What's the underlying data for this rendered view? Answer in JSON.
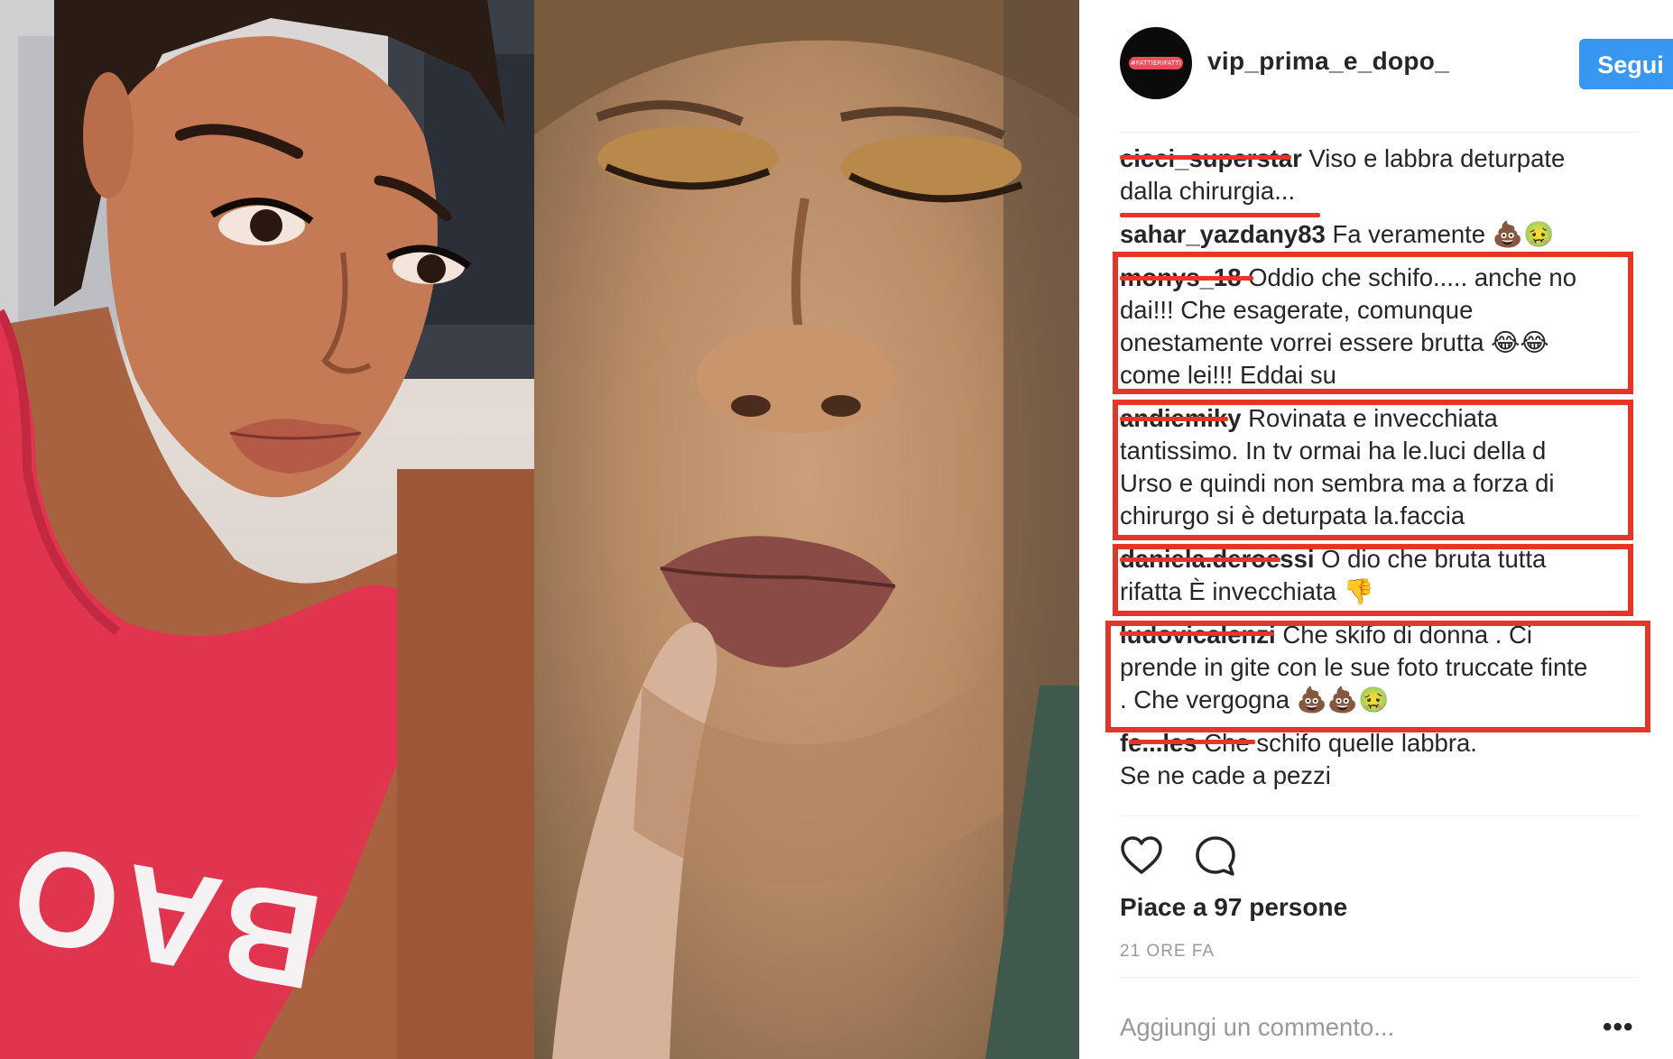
{
  "post": {
    "username": "vip_prima_e_dopo_",
    "avatar_badge": "#FATTIERIFATTI",
    "follow_label": "Segui",
    "likes_text": "Piace a 97 persone",
    "time_text": "21 ORE FA",
    "add_comment_placeholder": "Aggiungi un commento...",
    "more_label": "•••"
  },
  "photo": {
    "shirt_text": "BAO"
  },
  "comments": [
    {
      "user": "cicci_superstar",
      "lines": [
        "Viso e labbra deturpate",
        "dalla chirurgia..."
      ]
    },
    {
      "user": "sahar_yazdany83",
      "lines": [
        "Fa veramente 💩🤢"
      ]
    },
    {
      "user": "monys_18",
      "lines": [
        "Oddio che schifo..... anche no",
        "dai!!! Che esagerate, comunque",
        "onestamente vorrei essere brutta 😂😂",
        "come lei!!! Eddai su"
      ]
    },
    {
      "user": "andiemiky",
      "lines": [
        "Rovinata e invecchiata",
        "tantissimo. In tv ormai ha le.luci della d",
        "Urso e quindi non sembra ma a forza di",
        "chirurgo si è deturpata la.faccia"
      ]
    },
    {
      "user": "daniela.deroessi",
      "lines": [
        "O dio che bruta tutta",
        "rifatta È invecchiata 👎"
      ]
    },
    {
      "user": "ludovicalenzi",
      "lines": [
        "Che skifo di donna . Ci",
        "prende in gite con le sue foto truccate finte",
        ". Che vergogna 💩💩🤢"
      ]
    },
    {
      "user": "fe...les",
      "lines": [
        "Che schifo quelle labbra.",
        "Se ne cade a pezzi"
      ]
    }
  ],
  "colors": {
    "follow_button": "#3897f0",
    "highlight_box": "#e53527",
    "redaction": "#e8342b",
    "muted_text": "#999999"
  },
  "icons": [
    "heart-icon",
    "comment-icon",
    "more-icon"
  ]
}
